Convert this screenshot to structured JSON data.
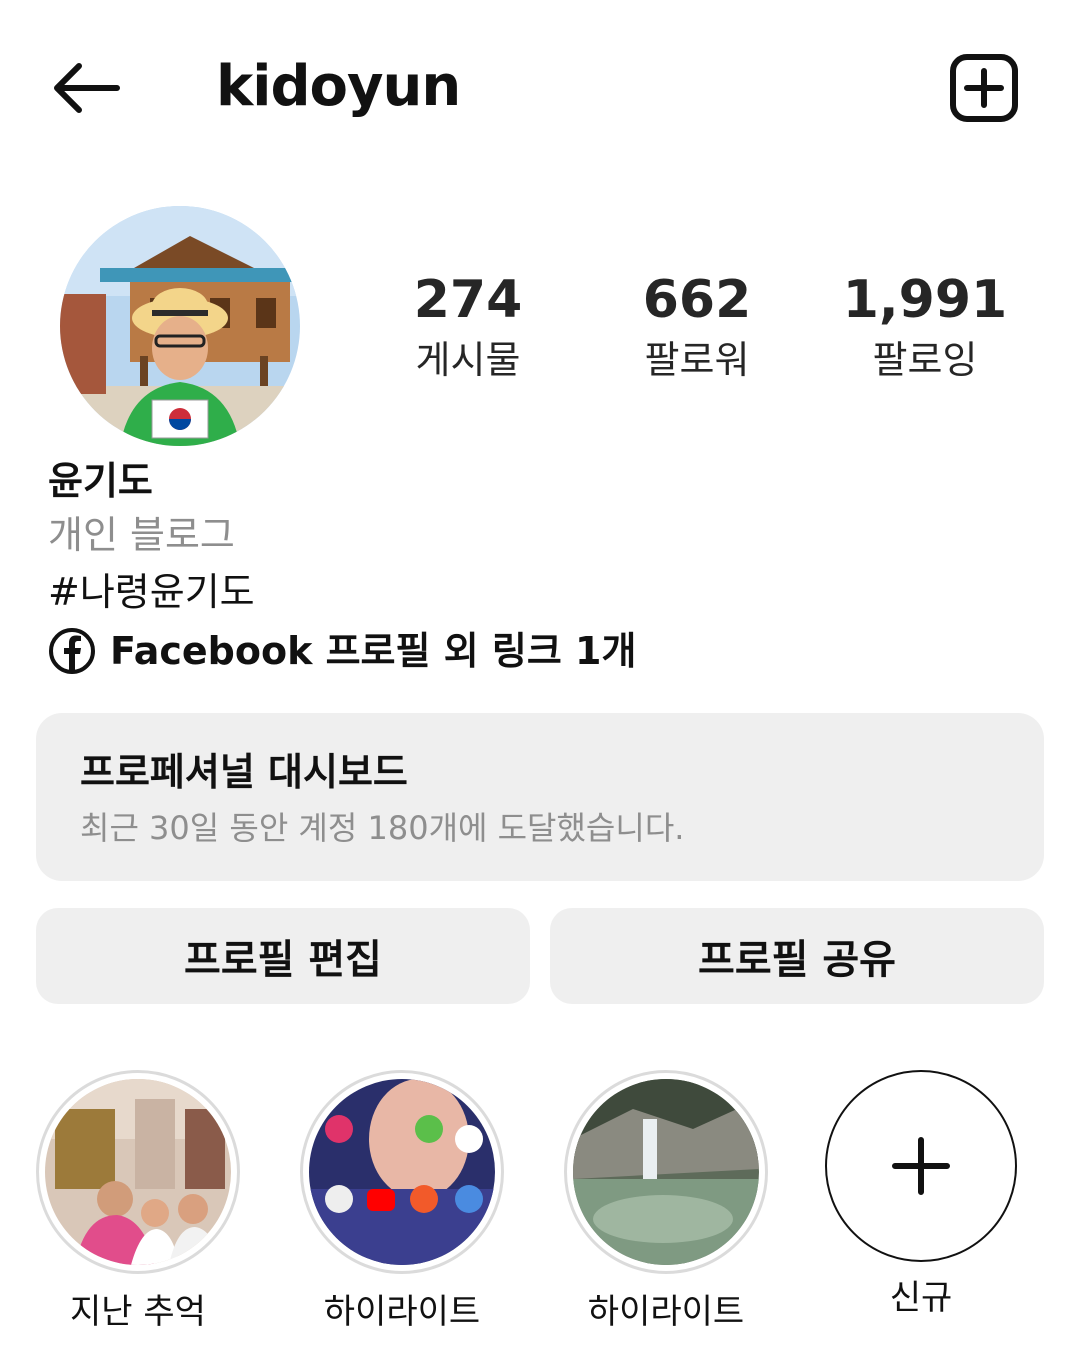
{
  "header": {
    "username": "kidoyun",
    "back_icon": "arrow-left-icon",
    "new_post_icon": "plus-square-icon"
  },
  "profile": {
    "avatar_icon": "profile-photo",
    "stats": [
      {
        "value": "274",
        "label": "게시물"
      },
      {
        "value": "662",
        "label": "팔로워"
      },
      {
        "value": "1,991",
        "label": "팔로잉"
      }
    ],
    "display_name": "윤기도",
    "category": "개인 블로그",
    "bio_hashtag": "#나령윤기도",
    "link_icon": "facebook-icon",
    "link_text": "Facebook 프로필 외 링크 1개"
  },
  "dashboard": {
    "title": "프로페셔널 대시보드",
    "subtitle": "최근 30일 동안 계정 180개에 도달했습니다."
  },
  "buttons": {
    "edit_profile": "프로필 편집",
    "share_profile": "프로필 공유"
  },
  "highlights": [
    {
      "label": "지난 추억"
    },
    {
      "label": "하이라이트"
    },
    {
      "label": "하이라이트"
    },
    {
      "label": "신규"
    }
  ],
  "colors": {
    "card_bg": "#efefef",
    "muted_text": "#8e8e8e",
    "primary_text": "#111111"
  }
}
